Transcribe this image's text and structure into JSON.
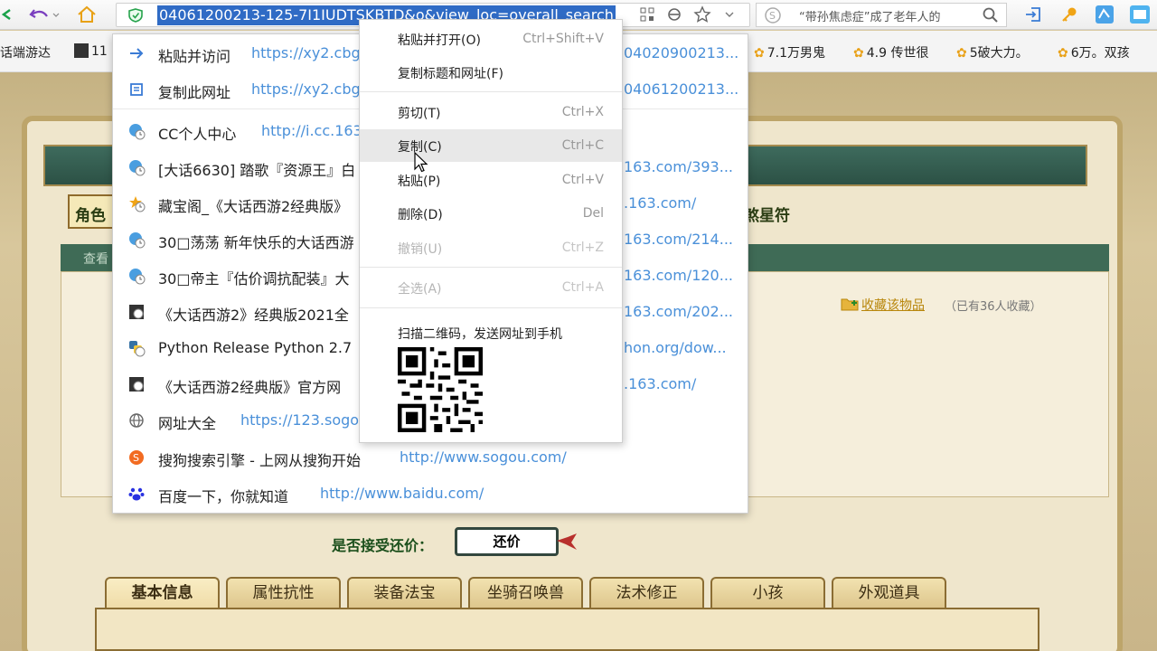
{
  "toolbar": {
    "address_url": "04061200213-125-7I1IUDTSKBTD&o&view_loc=overall_search",
    "search_text": "“带孙焦虑症”成了老年人的"
  },
  "bookmarks": [
    {
      "label": "话端游达"
    },
    {
      "label": "11"
    },
    {
      "label": "7.1万男鬼"
    },
    {
      "label": "4.9 传世很"
    },
    {
      "label": "5破大力。"
    },
    {
      "label": "6万。双孩"
    }
  ],
  "dropdown": {
    "items": [
      {
        "title": "粘贴并访问",
        "url": "https://xy2.cbg",
        "url_right": "04020900213...",
        "icon": "arrow-right-icon"
      },
      {
        "title": "复制此网址",
        "url": "https://xy2.cbg",
        "url_right": "04061200213...",
        "icon": "copy-box-icon"
      },
      {
        "title": "CC个人中心",
        "url": "http://i.cc.163",
        "url_right": "",
        "icon": "history-globe-icon"
      },
      {
        "title": "[大话6630] 踏歌『资源王』白",
        "url": "",
        "url_right": "163.com/393...",
        "icon": "history-globe-icon"
      },
      {
        "title": "藏宝阁_《大话西游2经典版》",
        "url": "",
        "url_right": ".163.com/",
        "icon": "history-star-icon"
      },
      {
        "title": "30□荡荡 新年快乐的大话西游",
        "url": "",
        "url_right": "163.com/214...",
        "icon": "history-globe-icon"
      },
      {
        "title": "30□帝主『估价调抗配装』大",
        "url": "",
        "url_right": "163.com/120...",
        "icon": "history-globe-icon"
      },
      {
        "title": "《大话西游2》经典版2021全",
        "url": "",
        "url_right": "163.com/202...",
        "icon": "game-icon"
      },
      {
        "title": "Python Release Python 2.7",
        "url": "",
        "url_right": "hon.org/dow...",
        "icon": "python-icon"
      },
      {
        "title": "《大话西游2经典版》官方网",
        "url": "",
        "url_right": ".163.com/",
        "icon": "game-icon"
      },
      {
        "title": "网址大全",
        "url": "https://123.sogo",
        "url_right": "",
        "icon": "globe-icon"
      },
      {
        "title": "搜狗搜索引擎 - 上网从搜狗开始",
        "url": "http://www.sogou.com/",
        "url_right": "",
        "icon": "sogou-icon"
      },
      {
        "title": "百度一下，你就知道",
        "url": "http://www.baidu.com/",
        "url_right": "",
        "icon": "baidu-paw-icon"
      }
    ]
  },
  "context_menu": {
    "items": [
      {
        "label": "粘贴并打开(O)",
        "shortcut": "Ctrl+Shift+V"
      },
      {
        "label": "复制标题和网址(F)",
        "shortcut": ""
      },
      {
        "label": "剪切(T)",
        "shortcut": "Ctrl+X"
      },
      {
        "label": "复制(C)",
        "shortcut": "Ctrl+C"
      },
      {
        "label": "粘贴(P)",
        "shortcut": "Ctrl+V"
      },
      {
        "label": "删除(D)",
        "shortcut": "Del"
      },
      {
        "label": "撤销(U)",
        "shortcut": "Ctrl+Z"
      },
      {
        "label": "全选(A)",
        "shortcut": "Ctrl+A"
      }
    ],
    "qr_caption": "扫描二维码，发送网址到手机"
  },
  "page": {
    "role_tab": "角色",
    "star_tab": "煞星符",
    "view_label": "查看",
    "favorite_link": "收藏该物品",
    "favorite_count": "（已有36人收藏）",
    "counter_label": "是否接受还价：",
    "counter_button": "还价",
    "tabs": [
      "基本信息",
      "属性抗性",
      "装备法宝",
      "坐骑召唤兽",
      "法术修正",
      "小孩",
      "外观道具"
    ]
  },
  "colors": {
    "selection": "#2f6bc5",
    "link": "#4a90d9",
    "menu_hover": "#e8e8e8"
  }
}
